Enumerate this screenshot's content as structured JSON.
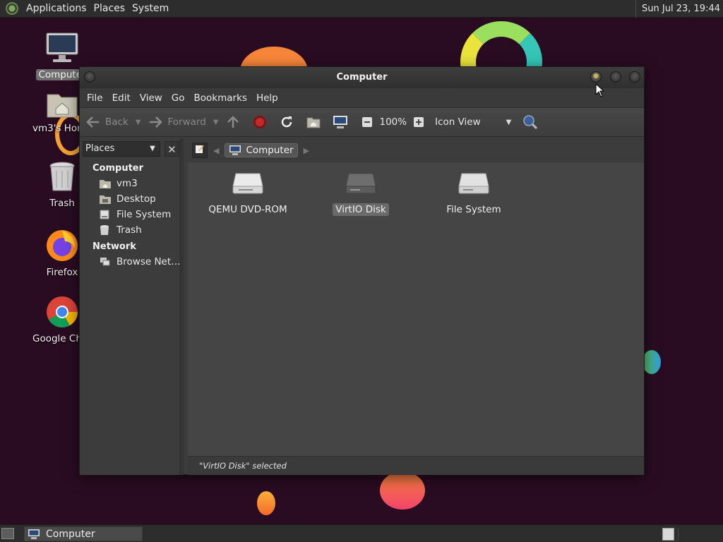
{
  "top_panel": {
    "menus": [
      "Applications",
      "Places",
      "System"
    ],
    "clock": "Sun Jul 23, 19:44"
  },
  "desktop_icons": [
    {
      "label": "Computer",
      "icon": "computer-icon"
    },
    {
      "label": "vm3's Home",
      "icon": "home-folder-icon"
    },
    {
      "label": "Trash",
      "icon": "trash-icon"
    },
    {
      "label": "Firefox",
      "icon": "firefox-icon"
    },
    {
      "label": "Google Chrome",
      "icon": "chrome-icon"
    }
  ],
  "window": {
    "title": "Computer",
    "menubar": [
      "File",
      "Edit",
      "View",
      "Go",
      "Bookmarks",
      "Help"
    ],
    "toolbar": {
      "back_label": "Back",
      "forward_label": "Forward",
      "zoom": "100%",
      "view_mode": "Icon View"
    },
    "sidebar": {
      "selector_label": "Places",
      "sections": [
        {
          "title": "Computer",
          "items": [
            "vm3",
            "Desktop",
            "File System",
            "Trash"
          ]
        },
        {
          "title": "Network",
          "items": [
            "Browse Net…"
          ]
        }
      ]
    },
    "pathbar": {
      "current": "Computer"
    },
    "files": [
      {
        "label": "QEMU DVD-ROM",
        "icon": "optical-drive-icon",
        "selected": false
      },
      {
        "label": "VirtIO Disk",
        "icon": "hard-disk-icon",
        "selected": true
      },
      {
        "label": "File System",
        "icon": "hard-disk-icon",
        "selected": false
      }
    ],
    "status": "\"VirtIO Disk\" selected"
  },
  "bottom_panel": {
    "tasks": [
      {
        "label": "Computer",
        "icon": "computer-icon"
      }
    ]
  },
  "colors": {
    "desktop_bg": "#2a0c22",
    "window_bg": "#3c3c3c",
    "content_bg": "#454545",
    "panel_bg": "#2d2d2d"
  }
}
